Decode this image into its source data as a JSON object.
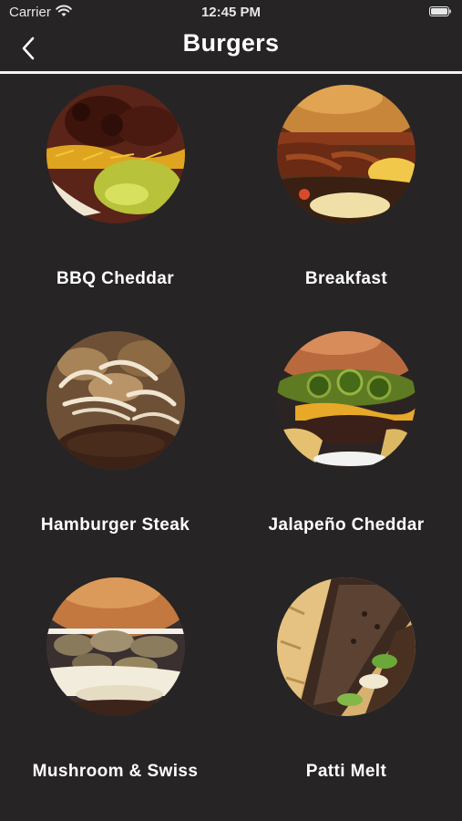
{
  "status_bar": {
    "carrier": "Carrier",
    "time": "12:45 PM",
    "wifi_icon": "wifi-icon",
    "battery_icon": "battery-icon"
  },
  "nav": {
    "title": "Burgers",
    "back_icon": "chevron-left-icon"
  },
  "colors": {
    "background": "#262425",
    "text": "#ffffff",
    "divider": "#f2f2f2"
  },
  "items": [
    {
      "label": "BBQ Cheddar"
    },
    {
      "label": "Breakfast"
    },
    {
      "label": "Hamburger Steak"
    },
    {
      "label": "Jalapeño Cheddar"
    },
    {
      "label": "Mushroom & Swiss"
    },
    {
      "label": "Patti Melt"
    }
  ]
}
